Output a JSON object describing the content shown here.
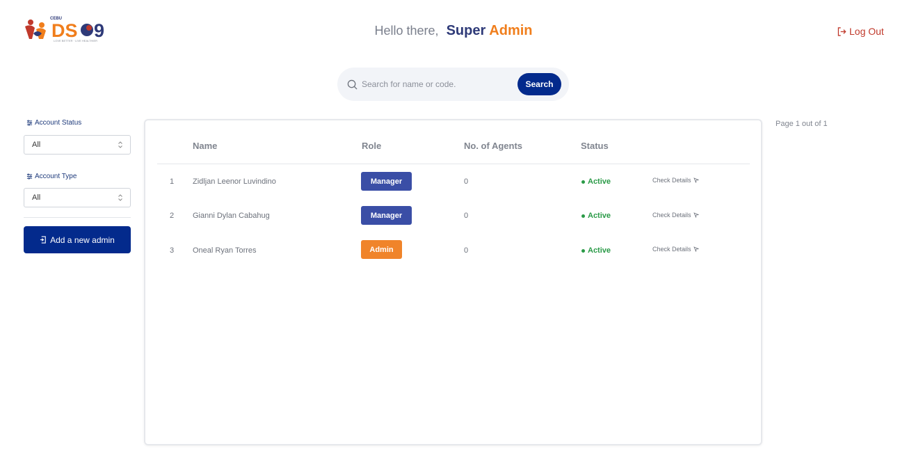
{
  "header": {
    "logo_text": "CEBU DSO9",
    "logo_tagline": "LOVE BETTER · LIVE HEALTHIER",
    "greeting_prefix": "Hello there,",
    "greeting_first": "Super",
    "greeting_second": "Admin",
    "logout_label": "Log Out"
  },
  "search": {
    "placeholder": "Search for name or code.",
    "button_label": "Search"
  },
  "sidebar": {
    "account_status_label": "Account Status",
    "account_status_value": "All",
    "account_type_label": "Account Type",
    "account_type_value": "All",
    "add_button_label": "Add a new admin"
  },
  "table": {
    "headers": [
      "Name",
      "Role",
      "No. of Agents",
      "Status"
    ],
    "rows": [
      {
        "index": "1",
        "name": "Zidljan Leenor Luvindino",
        "role": "Manager",
        "agents": "0",
        "status": "Active",
        "action": "Check Details"
      },
      {
        "index": "2",
        "name": "Gianni Dylan Cabahug",
        "role": "Manager",
        "agents": "0",
        "status": "Active",
        "action": "Check Details"
      },
      {
        "index": "3",
        "name": "Oneal Ryan Torres",
        "role": "Admin",
        "agents": "0",
        "status": "Active",
        "action": "Check Details"
      }
    ]
  },
  "pagination": {
    "label": "Page 1 out of 1"
  },
  "colors": {
    "primary": "#032a8c",
    "manager_badge": "#3a4ea6",
    "admin_badge": "#f07e1c",
    "status_active": "#2a9a47",
    "logout": "#c0392b"
  }
}
